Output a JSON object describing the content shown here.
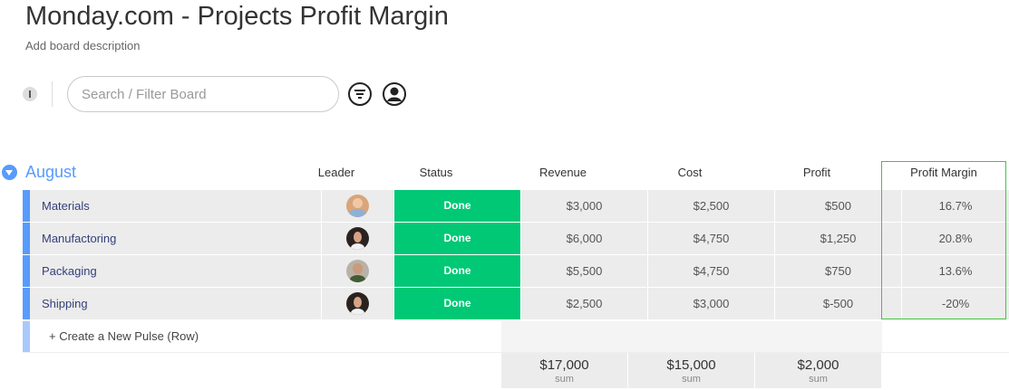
{
  "header": {
    "title": "Monday.com - Projects Profit Margin",
    "description": "Add board description"
  },
  "toolbar": {
    "search_placeholder": "Search / Filter Board",
    "filter_icon": "filter-icon",
    "person_icon": "person-icon"
  },
  "group": {
    "title": "August",
    "color": "#579bfc",
    "columns": {
      "leader": "Leader",
      "status": "Status",
      "revenue": "Revenue",
      "cost": "Cost",
      "profit": "Profit",
      "margin": "Profit Margin"
    },
    "rows": [
      {
        "name": "Materials",
        "status": "Done",
        "revenue": "$3,000",
        "cost": "$2,500",
        "profit": "$500",
        "margin": "16.7%"
      },
      {
        "name": "Manufactoring",
        "status": "Done",
        "revenue": "$6,000",
        "cost": "$4,750",
        "profit": "$1,250",
        "margin": "20.8%"
      },
      {
        "name": "Packaging",
        "status": "Done",
        "revenue": "$5,500",
        "cost": "$4,750",
        "profit": "$750",
        "margin": "13.6%"
      },
      {
        "name": "Shipping",
        "status": "Done",
        "revenue": "$2,500",
        "cost": "$3,000",
        "profit": "$-500",
        "margin": "-20%"
      }
    ],
    "create_label": "+ Create a New Pulse (Row)",
    "sums": {
      "revenue": "$17,000",
      "cost": "$15,000",
      "profit": "$2,000",
      "label": "sum"
    }
  },
  "colors": {
    "status_done": "#00c875",
    "highlight_border": "#3cc93f"
  }
}
